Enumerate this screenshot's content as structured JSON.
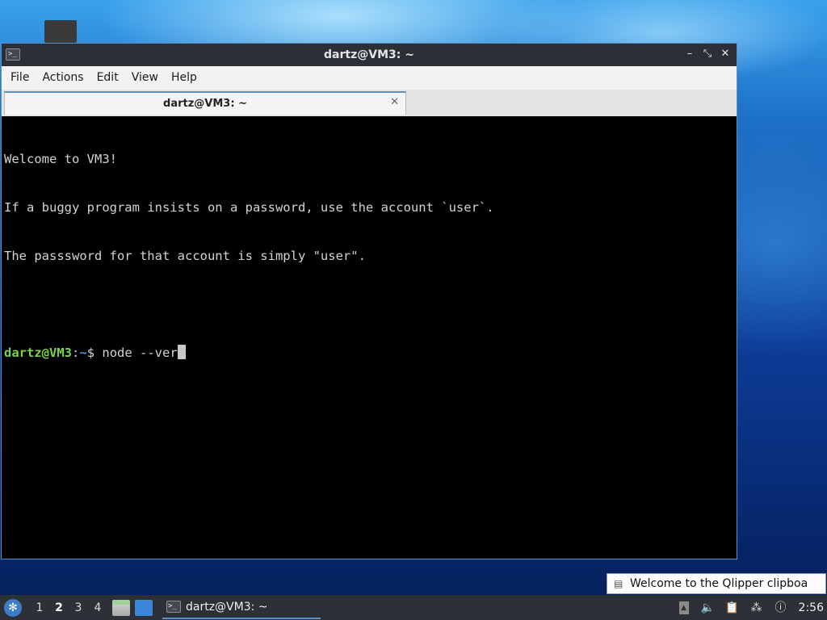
{
  "window": {
    "title": "dartz@VM3: ~",
    "minimize_label": "–",
    "maximize_label": "⤡",
    "close_label": "✕"
  },
  "menu": {
    "file": "File",
    "actions": "Actions",
    "edit": "Edit",
    "view": "View",
    "help": "Help"
  },
  "tab": {
    "label": "dartz@VM3: ~",
    "close_label": "✕"
  },
  "terminal": {
    "lines": [
      "Welcome to VM3!",
      "If a buggy program insists on a password, use the account `user`.",
      "The passsword for that account is simply \"user\"."
    ],
    "prompt_user": "dartz@VM3",
    "prompt_sep": ":",
    "prompt_path": "~",
    "prompt_symbol": "$ ",
    "command": "node --ver"
  },
  "notification": {
    "text": "Welcome to the Qlipper clipboa",
    "icon": "clipboard-icon"
  },
  "taskbar": {
    "start_icon": "start-menu-icon",
    "desktops": [
      "1",
      "2",
      "3",
      "4"
    ],
    "active_desktop": "2",
    "task_label": "dartz@VM3: ~",
    "clock": "2:56"
  },
  "colors": {
    "prompt_user": "#7cd34a",
    "prompt_path": "#5a8fe0",
    "accent": "#5e8fc6"
  }
}
